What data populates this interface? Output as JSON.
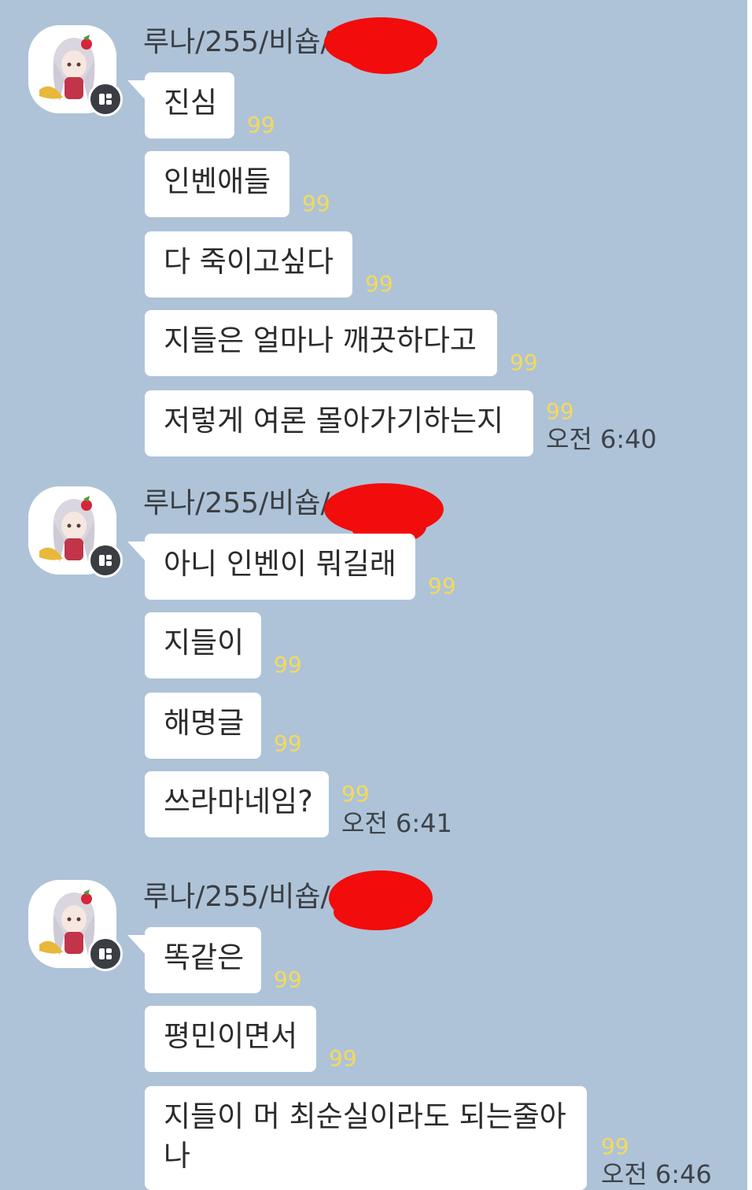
{
  "colors": {
    "chat_background": "#aec3d8",
    "bubble": "#ffffff",
    "unread_count": "#f5d95a",
    "redaction": "#f20c0c"
  },
  "icons": {
    "avatar": "anime-character-avatar",
    "badge": "openchat-profile-badge-icon"
  },
  "groups": [
    {
      "sender": "루나/255/비숍/",
      "messages": [
        {
          "text": "진심",
          "unread": "99"
        },
        {
          "text": "인벤애들",
          "unread": "99"
        },
        {
          "text": "다 죽이고싶다",
          "unread": "99"
        },
        {
          "text": "지들은 얼마나 깨끗하다고",
          "unread": "99"
        },
        {
          "text": "저렇게  여론 몰아가기하는지",
          "unread": "99",
          "time": "오전 6:40"
        }
      ]
    },
    {
      "sender": "루나/255/비숍/",
      "messages": [
        {
          "text": "아니 인벤이 뭐길래",
          "unread": "99"
        },
        {
          "text": "지들이",
          "unread": "99"
        },
        {
          "text": "해명글",
          "unread": "99"
        },
        {
          "text": "쓰라마네임?",
          "unread": "99",
          "time": "오전 6:41"
        }
      ]
    },
    {
      "sender": "루나/255/비숍/",
      "messages": [
        {
          "text": "똑같은",
          "unread": "99"
        },
        {
          "text": "평민이면서",
          "unread": "99"
        },
        {
          "text": "지들이 머 최순실이라도 되는줄아",
          "text_line2": "나",
          "unread": "99",
          "time": "오전 6:46"
        }
      ]
    }
  ]
}
